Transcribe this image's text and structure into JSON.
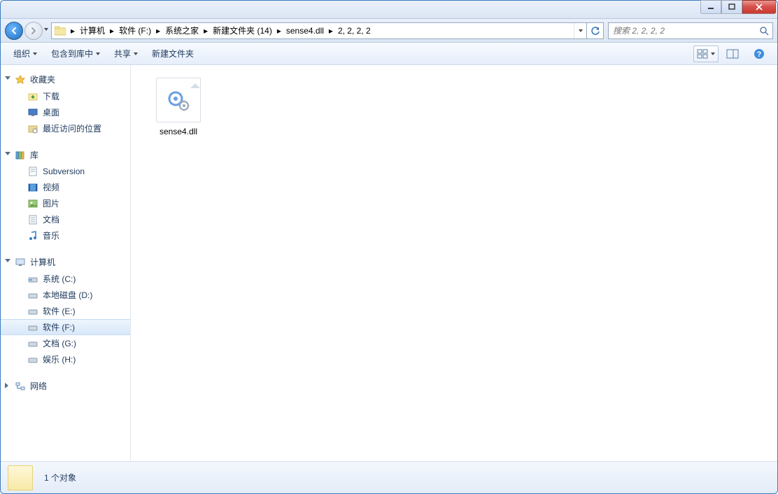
{
  "breadcrumb": {
    "items": [
      "计算机",
      "软件 (F:)",
      "系统之家",
      "新建文件夹 (14)",
      "sense4.dll",
      "2, 2, 2, 2"
    ]
  },
  "search": {
    "placeholder": "搜索 2, 2, 2, 2"
  },
  "toolbar": {
    "organize": "组织",
    "include": "包含到库中",
    "share": "共享",
    "newfolder": "新建文件夹"
  },
  "nav": {
    "favorites": {
      "label": "收藏夹",
      "items": [
        "下载",
        "桌面",
        "最近访问的位置"
      ]
    },
    "libraries": {
      "label": "库",
      "items": [
        "Subversion",
        "视频",
        "图片",
        "文档",
        "音乐"
      ]
    },
    "computer": {
      "label": "计算机",
      "items": [
        "系统 (C:)",
        "本地磁盘 (D:)",
        "软件 (E:)",
        "软件 (F:)",
        "文档 (G:)",
        "娱乐 (H:)"
      ]
    },
    "network": {
      "label": "网络"
    }
  },
  "files": [
    {
      "name": "sense4.dll"
    }
  ],
  "status": {
    "count": "1 个对象"
  }
}
